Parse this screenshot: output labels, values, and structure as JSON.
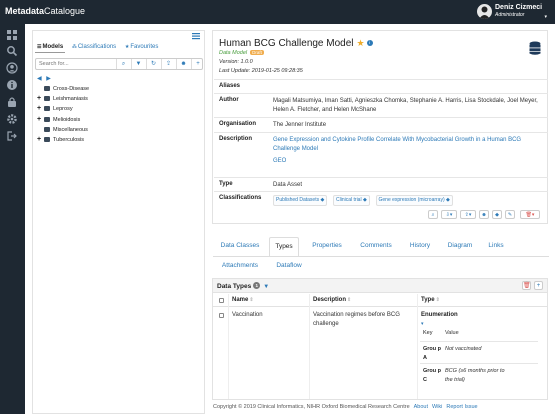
{
  "app": {
    "brand_bold": "Metadata",
    "brand_rest": "Catalogue"
  },
  "user": {
    "name": "Deniz Cizmeci",
    "role": "Administrator"
  },
  "sidebar": {
    "tabs": [
      {
        "label": "Models",
        "icon": "list-icon"
      },
      {
        "label": "Classifications",
        "icon": "sitemap-icon"
      },
      {
        "label": "Favourites",
        "icon": "star-icon"
      }
    ],
    "search_placeholder": "Search for...",
    "tree": [
      {
        "label": "Cross-Disease",
        "expandable": false
      },
      {
        "label": "Leishmaniasis",
        "expandable": true
      },
      {
        "label": "Leprosy",
        "expandable": true
      },
      {
        "label": "Melioidosis",
        "expandable": true
      },
      {
        "label": "Miscellaneous",
        "expandable": false
      },
      {
        "label": "Tuberculosis",
        "expandable": true
      }
    ]
  },
  "model": {
    "title": "Human BCG Challenge Model",
    "type_label": "Data Model",
    "status_badge": "Draft",
    "version": "Version: 1.0.0",
    "last_update": "Last Update: 2019-01-25 09:28:35",
    "aliases": "",
    "author": "Magali Matsumiya, Iman Satti, Agnieszka Chomka, Stephanie A. Harris, Lisa Stockdale, Joel Meyer, Helen A. Fletcher, and Helen McShane",
    "organisation": "The Jenner Institute",
    "description_link": "Gene Expression and Cytokine Profile Correlate With Mycobacterial Growth in a Human BCG Challenge Model",
    "description_geo": "GEO",
    "type": "Data Asset",
    "classifications": [
      "Published Datasets",
      "Clinical trial",
      "Gene expression (microarray)"
    ],
    "labels": {
      "aliases": "Aliases",
      "author": "Author",
      "organisation": "Organisation",
      "description": "Description",
      "type": "Type",
      "classifications": "Classifications"
    }
  },
  "tabs": [
    "Data Classes",
    "Types",
    "Properties",
    "Comments",
    "History",
    "Diagram",
    "Links",
    "Attachments",
    "Dataflow"
  ],
  "active_tab": "Types",
  "data_types": {
    "title": "Data Types",
    "count": "1",
    "columns": {
      "name": "Name",
      "description": "Description",
      "type": "Type"
    },
    "rows": [
      {
        "name": "Vaccination",
        "description": "Vaccination regimes before BCG challenge",
        "type": "Enumeration",
        "enum_headers": {
          "key": "Key",
          "value": "Value"
        },
        "enum": [
          {
            "key": "Grou p A",
            "value": "Not vaccinated"
          },
          {
            "key": "Grou p C",
            "value": "BCG (≥6 months prior to the trial)"
          }
        ]
      }
    ]
  },
  "footer": {
    "copyright": "Copyright © 2019 Clinical Informatics, NIHR Oxford Biomedical Research Centre",
    "links": [
      "About",
      "Wiki",
      "Report Issue"
    ]
  }
}
